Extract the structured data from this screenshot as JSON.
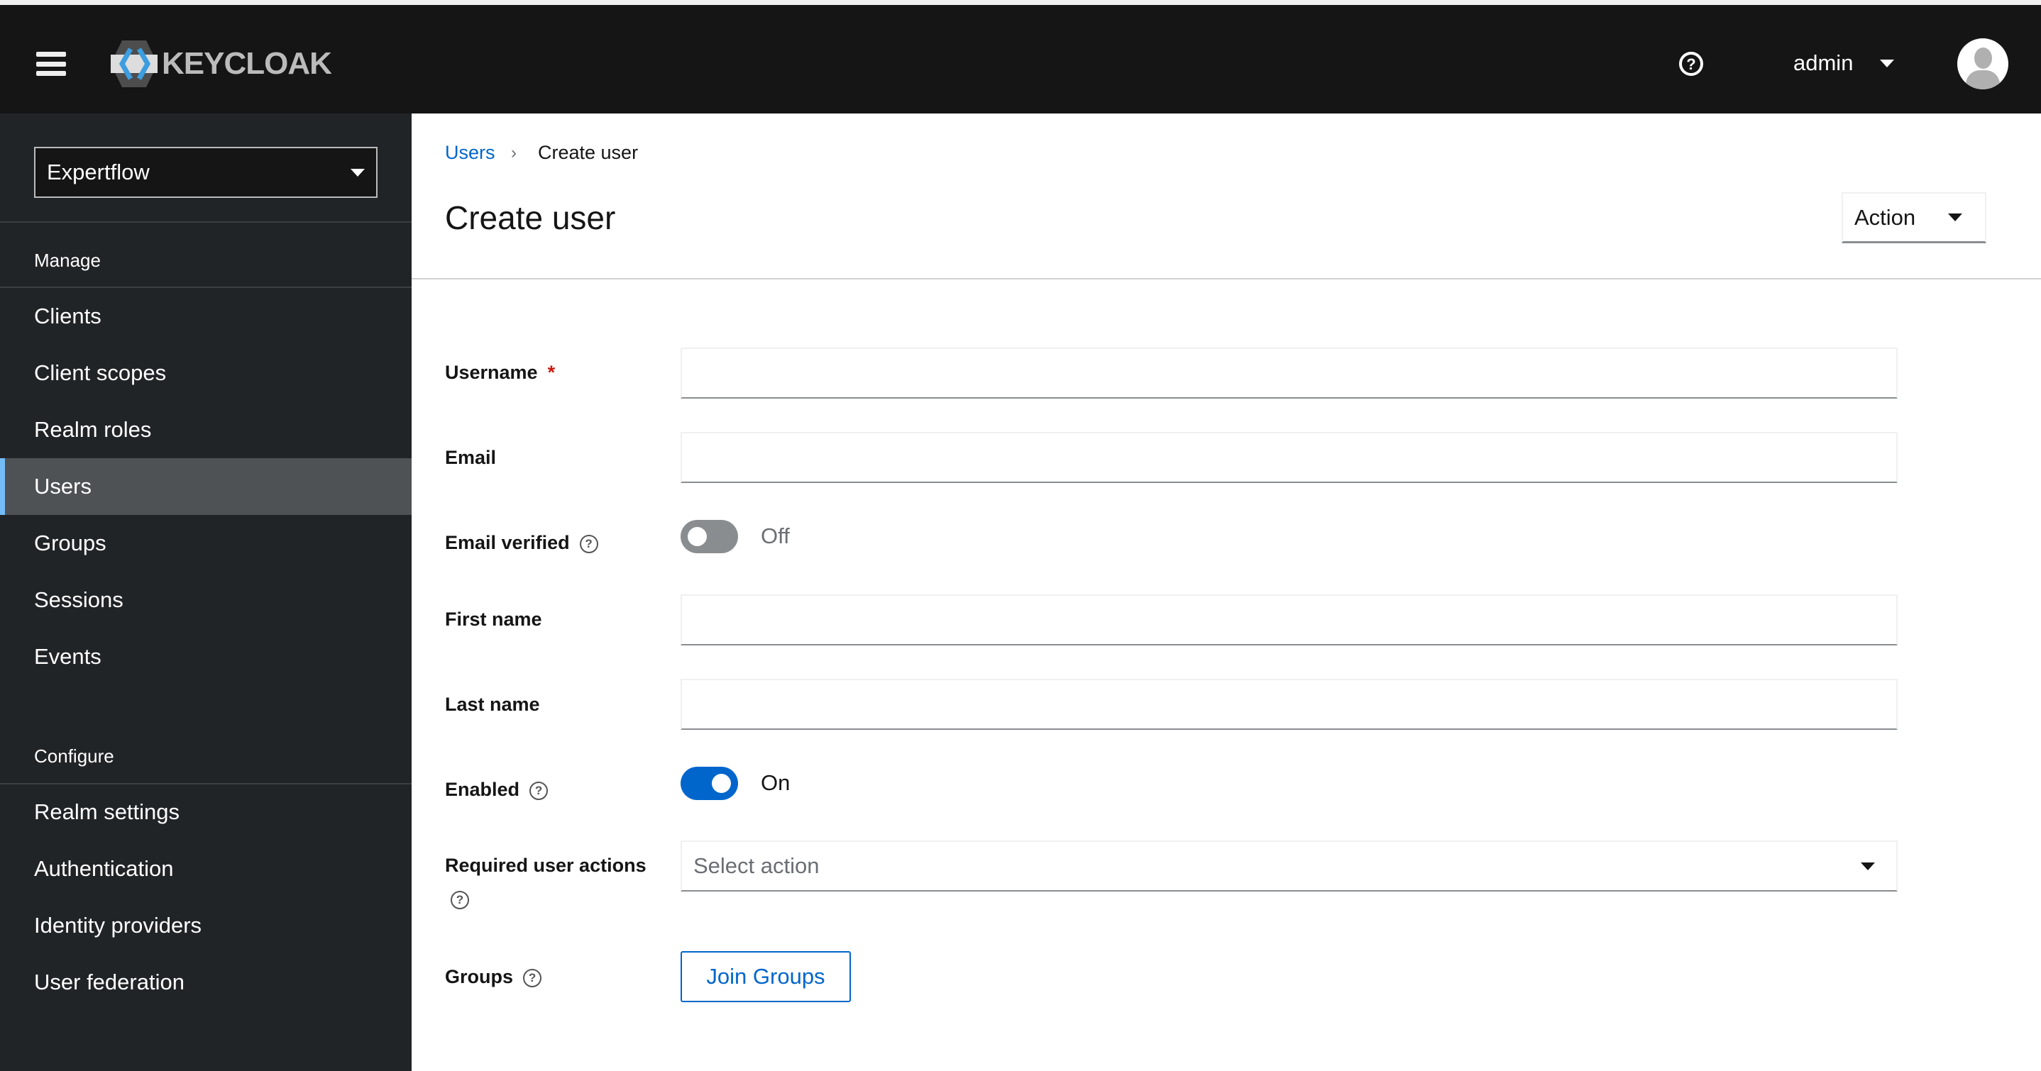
{
  "header": {
    "logo": "KEYCLOAK",
    "user": "admin",
    "icons": [
      "menu-icon",
      "help-icon",
      "caret-down-icon",
      "avatar"
    ]
  },
  "sidebar": {
    "realm": "Expertflow",
    "manage_label": "Manage",
    "manage_items": [
      {
        "label": "Clients"
      },
      {
        "label": "Client scopes"
      },
      {
        "label": "Realm roles"
      },
      {
        "label": "Users",
        "active": true
      },
      {
        "label": "Groups"
      },
      {
        "label": "Sessions"
      },
      {
        "label": "Events"
      }
    ],
    "configure_label": "Configure",
    "configure_items": [
      {
        "label": "Realm settings"
      },
      {
        "label": "Authentication"
      },
      {
        "label": "Identity providers"
      },
      {
        "label": "User federation"
      }
    ]
  },
  "breadcrumb": {
    "parent": "Users",
    "current": "Create user"
  },
  "page": {
    "title": "Create user",
    "action_label": "Action"
  },
  "form": {
    "username_label": "Username",
    "required_mark": "*",
    "username_value": "",
    "email_label": "Email",
    "email_value": "",
    "email_verified_label": "Email verified",
    "email_verified_state": "Off",
    "first_name_label": "First name",
    "first_name_value": "",
    "last_name_label": "Last name",
    "last_name_value": "",
    "enabled_label": "Enabled",
    "enabled_state": "On",
    "required_actions_label": "Required user actions",
    "required_actions_placeholder": "Select action",
    "groups_label": "Groups",
    "join_groups_label": "Join Groups"
  },
  "colors": {
    "accent": "#0066cc",
    "toggle_on": "#0066cc",
    "toggle_off": "#8a8d90",
    "header_bg": "#151515",
    "sidebar_bg": "#212427"
  }
}
